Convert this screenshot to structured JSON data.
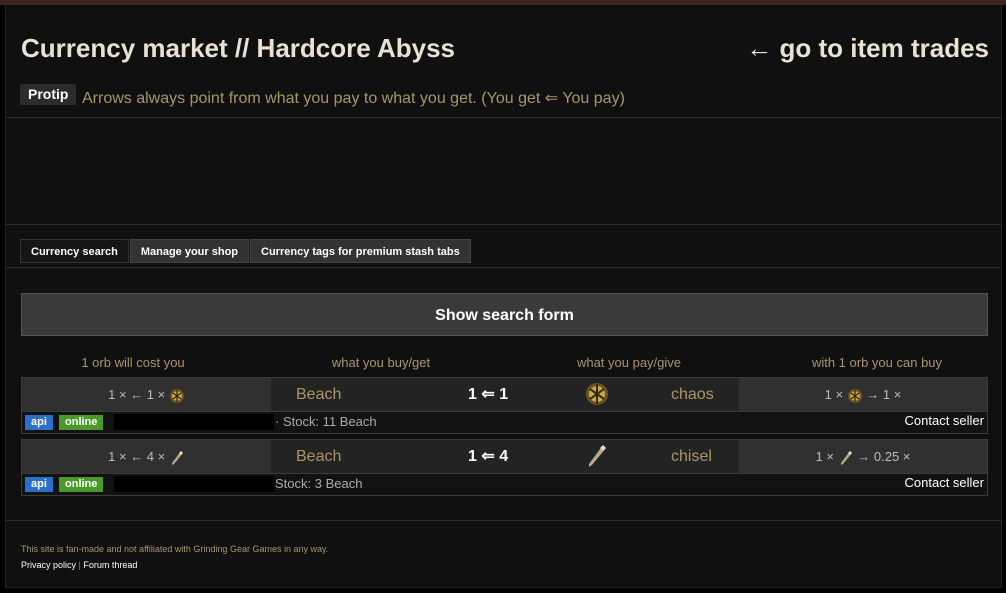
{
  "header": {
    "title": "Currency market // Hardcore Abyss",
    "go_link": "← go to item trades",
    "protip_label": "Protip",
    "protip_text": "Arrows always point from what you pay to what you get. (You get ⇐ You pay)"
  },
  "tabs": [
    {
      "label": "Currency search",
      "active": true
    },
    {
      "label": "Manage your shop",
      "active": false
    },
    {
      "label": "Currency tags for premium stash tabs",
      "active": false
    }
  ],
  "show_search_label": "Show search form",
  "columns": [
    "1 orb will cost you",
    "what you buy/get",
    "what you pay/give",
    "with 1 orb you can buy"
  ],
  "offers": [
    {
      "cost_prefix": "1 ×",
      "cost_arrow": "← 1 ×",
      "cost_icon": "chaos-orb-icon",
      "buy": "Beach",
      "ratio_get": "1",
      "ratio_arrow": "⇐",
      "ratio_pay": "1",
      "pay_icon": "chaos-orb-icon",
      "pay": "chaos",
      "rate_prefix": "1 ×",
      "rate_arrow": "→ 1 ×",
      "rate_icon": "chaos-orb-icon",
      "api": "api",
      "status": "online",
      "stock": "· Stock: 11 Beach",
      "contact": "Contact seller"
    },
    {
      "cost_prefix": "1 ×",
      "cost_arrow": "← 4 ×",
      "cost_icon": "chisel-icon",
      "buy": "Beach",
      "ratio_get": "1",
      "ratio_arrow": "⇐",
      "ratio_pay": "4",
      "pay_icon": "chisel-icon",
      "pay": "chisel",
      "rate_prefix": "1 ×",
      "rate_arrow": "→ 0.25 ×",
      "rate_icon": "chisel-icon",
      "api": "api",
      "status": "online",
      "stock": "Stock: 3 Beach",
      "contact": "Contact seller"
    }
  ],
  "footer": {
    "disclaimer": "This site is fan-made and not affiliated with Grinding Gear Games in any way.",
    "privacy": "Privacy policy",
    "separator": "|",
    "forum": "Forum thread"
  },
  "colors": {
    "accent_gold": "#a9956a",
    "api_blue": "#2a6fc9",
    "online_green": "#4a9a2a"
  }
}
